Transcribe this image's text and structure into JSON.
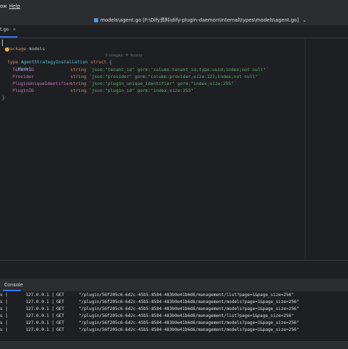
{
  "menu": {
    "item1": "ow",
    "item2": "Help"
  },
  "title_path": "models\\agent.go [F:\\Dify资料\\dify-plugin-daemon\\internal\\types\\models\\agent.go]",
  "title_chevron": "⌄",
  "tab": {
    "label": "t.go",
    "close": "×"
  },
  "code": {
    "line1": {
      "kw": "package",
      "name": " models"
    },
    "line3": {
      "kw": "type ",
      "name": "AgentStrategyInstallation",
      "kw2": " struct",
      "brace": " {",
      "usages": "9 usages",
      "author": "Yeuoly"
    },
    "line4": "Model",
    "fields": [
      {
        "name": "TenantID",
        "type": "string",
        "tag1": "json:\"tenant_id\"",
        "tag2": "gorm:\"column:tenant_id;type:uuid;index;not null\""
      },
      {
        "name": "Provider",
        "type": "string",
        "tag1": "json:\"provider\"",
        "tag2": "gorm:\"column:provider;size:127;index;not null\""
      },
      {
        "name": "PluginUniqueIdentifier",
        "type": "string",
        "tag1": "json:\"plugin_unique_identifier\"",
        "tag2": "gorm:\"index;size:255\""
      },
      {
        "name": "PluginID",
        "type": "string",
        "tag1": "json:\"plugin_id\"",
        "tag2": "gorm:\"index;size:255\""
      }
    ],
    "close": "}"
  },
  "console": {
    "tab_label": "Console",
    "rows": [
      {
        "prefix": "s |",
        "ip": "127.0.0.1 |",
        "method": "GET",
        "path": "\"/plugin/56f205c6-6d2c-45b5-8584-483b9e41b6d6/management/list?page=1&page_size=256\""
      },
      {
        "prefix": "s |",
        "ip": "127.0.0.1 |",
        "method": "GET",
        "path": "\"/plugin/56f205c6-6d2c-45b5-8584-483b9e41b6d6/management/models?page=1&page_size=256\""
      },
      {
        "prefix": "s |",
        "ip": "127.0.0.1 |",
        "method": "GET",
        "path": "\"/plugin/56f205c6-6d2c-45b5-8584-483b9e41b6d6/management/models?page=1&page_size=256\""
      },
      {
        "prefix": "s |",
        "ip": "127.0.0.1 |",
        "method": "GET",
        "path": "\"/plugin/56f205c6-6d2c-45b5-8584-483b9e41b6d6/management/list?page=1&page_size=256\""
      },
      {
        "prefix": "s |",
        "ip": "127.0.0.1 |",
        "method": "GET",
        "path": "\"/plugin/56f205c6-6d2c-45b5-8584-483b9e41b6d6/management/models?page=1&page_size=256\""
      },
      {
        "prefix": "s |",
        "ip": "127.0.0.1 |",
        "method": "GET",
        "path": "\"/plugin/56f205c6-6d2c-45b5-8584-483b9e41b6d6/management/models?page=1&page_size=256\""
      }
    ]
  }
}
